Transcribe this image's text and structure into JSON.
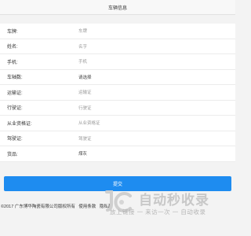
{
  "header": {
    "title": "车辆信息"
  },
  "form": {
    "rows": [
      {
        "label": "车牌:",
        "value": "车牌"
      },
      {
        "label": "姓名:",
        "value": "名字"
      },
      {
        "label": "手机:",
        "value": "手机"
      },
      {
        "label": "车轴数:",
        "value": "请选择"
      },
      {
        "label": "运输证:",
        "value": "运输证"
      },
      {
        "label": "行驶证:",
        "value": "行驶证"
      },
      {
        "label": "从业资格证:",
        "value": "从业资格证"
      },
      {
        "label": "驾驶证:",
        "value": "驾驶证"
      },
      {
        "label": "货品:",
        "value": "煤灰"
      }
    ]
  },
  "submit_label": "提交",
  "footer": {
    "copyright": "©2017  广东博华陶瓷有限公司版权所有",
    "terms": "使用条款",
    "privacy": "隐私政"
  },
  "watermark": {
    "title": "自动秒收录",
    "subtitle": "放上链接 一 来访一次 一 自动收录"
  },
  "colors": {
    "accent": "#1e8cf0",
    "background": "#f3f3f3"
  }
}
